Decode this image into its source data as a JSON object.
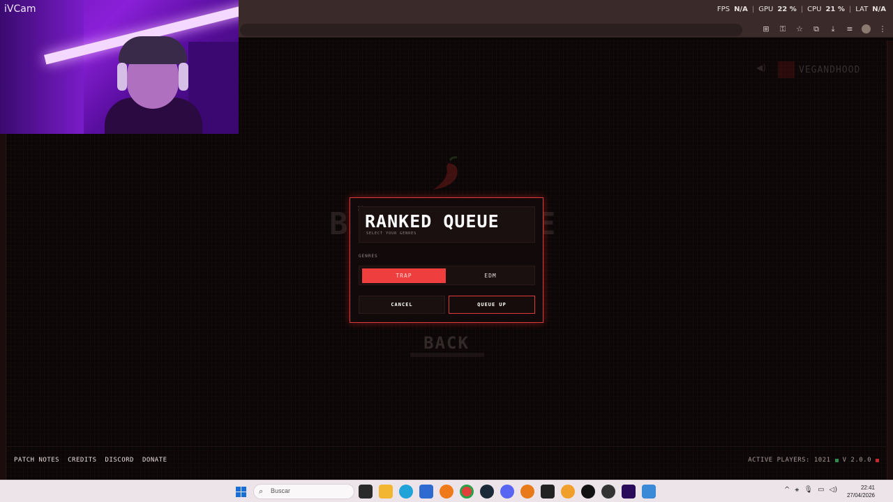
{
  "overlay": {
    "fps_label": "FPS",
    "fps_value": "N/A",
    "gpu_label": "GPU",
    "gpu_value": "22 %",
    "cpu_label": "CPU",
    "cpu_value": "21 %",
    "lat_label": "LAT",
    "lat_value": "N/A"
  },
  "webcam": {
    "app_label": "iVCam"
  },
  "background": {
    "profile_name": "VEGANDHOOD",
    "title_left": "B",
    "title_right": "E",
    "back_label": "BACK"
  },
  "modal": {
    "close": "×",
    "title": "RANKED QUEUE",
    "subtitle": "SELECT YOUR GENRES",
    "genres_label": "GENRES",
    "genres": [
      {
        "label": "TRAP",
        "selected": true
      },
      {
        "label": "EDM",
        "selected": false
      }
    ],
    "cancel_label": "CANCEL",
    "queue_label": "QUEUE UP",
    "accent_color": "#ef3e3e"
  },
  "footer": {
    "links": [
      "PATCH NOTES",
      "CREDITS",
      "DISCORD",
      "DONATE"
    ],
    "active_players": "ACTIVE PLAYERS: 1021",
    "version": "V 2.0.0"
  },
  "taskbar": {
    "search_placeholder": "Buscar",
    "time": "22:41",
    "date": "27/04/2026",
    "icons": [
      "task-view-icon",
      "file-explorer-icon",
      "edge-icon",
      "store-icon",
      "firefox-icon",
      "chrome-icon",
      "steam-icon",
      "discord-icon",
      "app-icon",
      "capcut-icon",
      "search-app-icon",
      "tiktok-icon",
      "obs-icon",
      "premiere-icon",
      "ivcam-icon"
    ]
  }
}
